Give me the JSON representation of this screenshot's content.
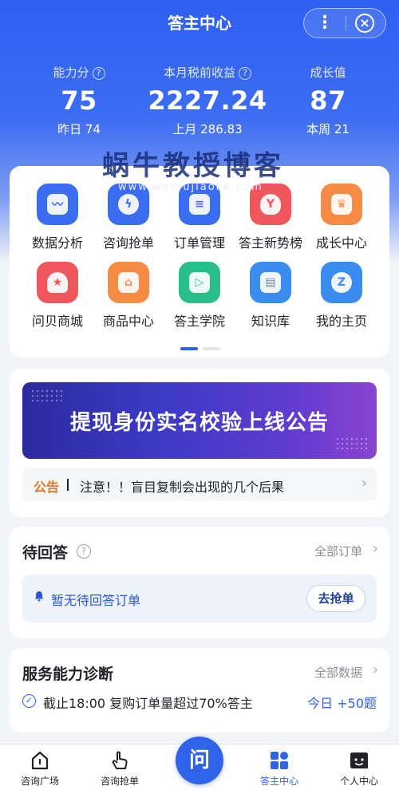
{
  "header": {
    "title": "答主中心"
  },
  "stats": [
    {
      "label": "能力分",
      "value": "75",
      "sub": "昨日 74"
    },
    {
      "label": "本月税前收益",
      "value": "2227.24",
      "sub": "上月 286.83"
    },
    {
      "label": "成长值",
      "value": "87",
      "sub": "本周 21"
    }
  ],
  "watermark": {
    "text": "蜗牛教授博客",
    "url": "www.woniujiaoke.com"
  },
  "grid": [
    {
      "label": "数据分析",
      "icon": "chart-line-icon",
      "color": "#3b6df0"
    },
    {
      "label": "咨询抢单",
      "icon": "lightning-icon",
      "color": "#3b6df0"
    },
    {
      "label": "订单管理",
      "icon": "document-icon",
      "color": "#3b6df0"
    },
    {
      "label": "答主新势榜",
      "icon": "trophy-icon",
      "color": "#f0575d"
    },
    {
      "label": "成长中心",
      "icon": "crown-icon",
      "color": "#f58b45"
    },
    {
      "label": "问贝商城",
      "icon": "shell-icon",
      "color": "#f0575d"
    },
    {
      "label": "商品中心",
      "icon": "store-icon",
      "color": "#f58b45"
    },
    {
      "label": "答主学院",
      "icon": "play-icon",
      "color": "#27c08a"
    },
    {
      "label": "知识库",
      "icon": "book-icon",
      "color": "#3b8cf0"
    },
    {
      "label": "我的主页",
      "icon": "zhihu-logo-icon",
      "color": "#3b8cf0"
    }
  ],
  "notice": {
    "banner_text": "提现身份实名校验上线公告",
    "tag": "公告",
    "message": "注意！！盲目复制会出现的几个后果"
  },
  "pending": {
    "title": "待回答",
    "link": "全部订单",
    "empty_text": "暂无待回答订单",
    "button": "去抢单"
  },
  "diagnosis": {
    "title": "服务能力诊断",
    "link": "全部数据",
    "item": "截止18:00 复购订单量超过70%答主",
    "item_link": "今日 +50题"
  },
  "tabs": [
    {
      "label": "咨询广场",
      "icon": "home-icon"
    },
    {
      "label": "咨询抢单",
      "icon": "hand-tap-icon"
    },
    {
      "label": "问",
      "icon": "ask-button"
    },
    {
      "label": "答主中心",
      "icon": "grid-shapes-icon"
    },
    {
      "label": "个人中心",
      "icon": "face-icon"
    }
  ],
  "colors": {
    "primary": "#2f63e9",
    "notice_tag": "#e8711f"
  }
}
